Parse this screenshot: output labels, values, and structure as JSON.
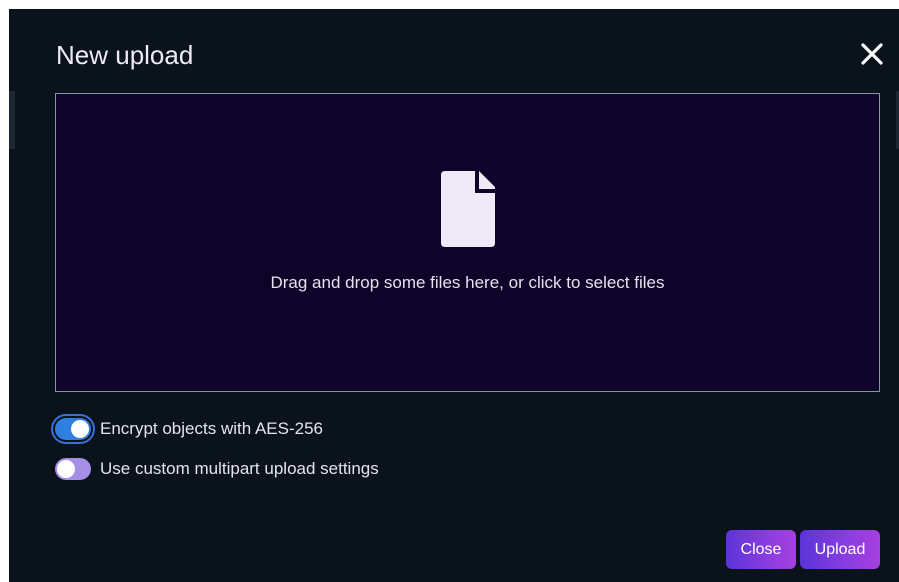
{
  "dialog": {
    "title": "New upload",
    "close_icon": "close-x-icon"
  },
  "dropzone": {
    "icon": "file-icon",
    "text": "Drag and drop some files here, or click to select files"
  },
  "options": [
    {
      "label": "Encrypt objects with AES-256",
      "checked": true
    },
    {
      "label": "Use custom multipart upload settings",
      "checked": false
    }
  ],
  "buttons": {
    "close_label": "Close",
    "upload_label": "Upload"
  },
  "colors": {
    "modal_bg": "#0a131b",
    "dropzone_bg": "#0e0328",
    "toggle_on": "#2f7fe0",
    "toggle_off": "#a58ee6",
    "button_gradient_start": "#5b34d8",
    "button_gradient_end": "#a63fe0"
  }
}
